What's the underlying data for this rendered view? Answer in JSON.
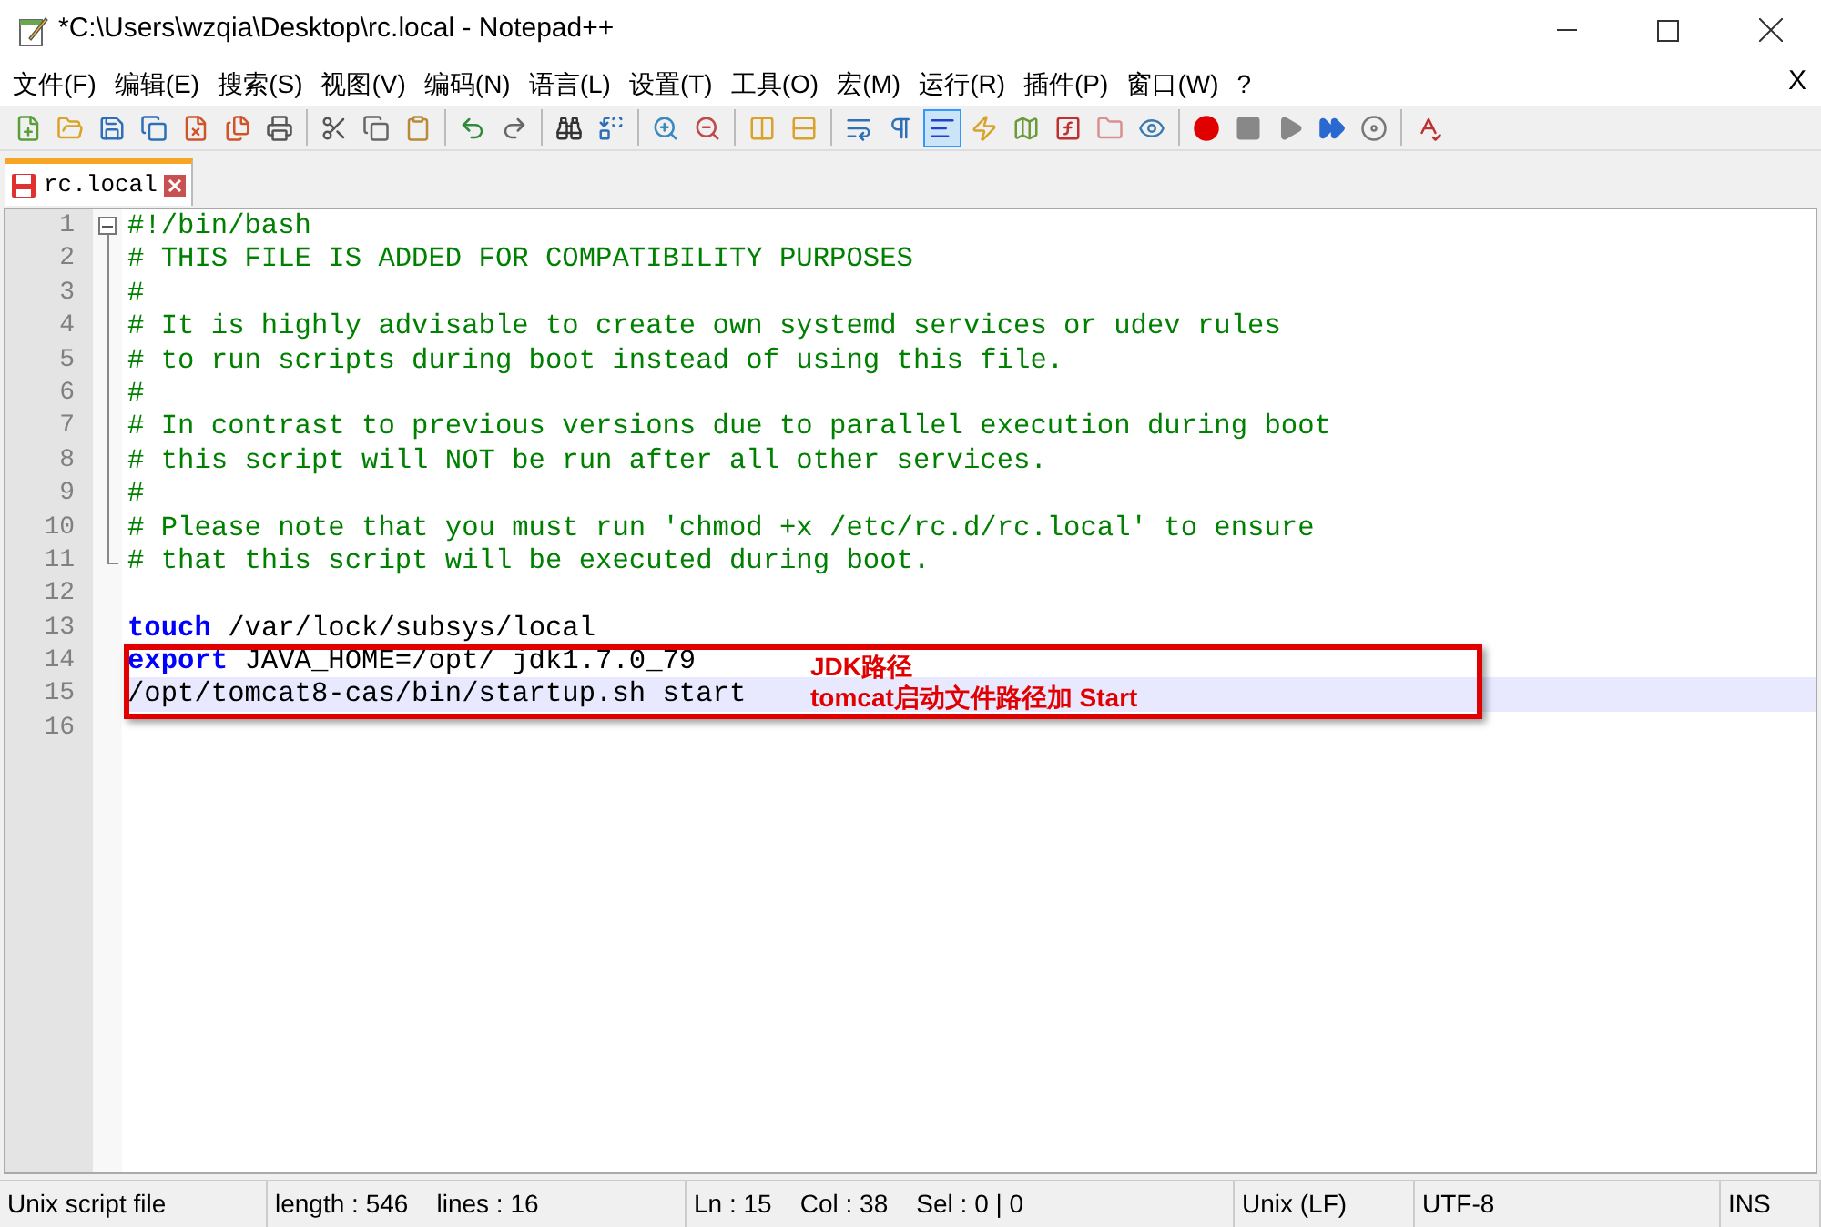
{
  "window": {
    "title": "*C:\\Users\\wzqia\\Desktop\\rc.local - Notepad++"
  },
  "menu": [
    {
      "label": "文件(F)"
    },
    {
      "label": "编辑(E)"
    },
    {
      "label": "搜索(S)"
    },
    {
      "label": "视图(V)"
    },
    {
      "label": "编码(N)"
    },
    {
      "label": "语言(L)"
    },
    {
      "label": "设置(T)"
    },
    {
      "label": "工具(O)"
    },
    {
      "label": "宏(M)"
    },
    {
      "label": "运行(R)"
    },
    {
      "label": "插件(P)"
    },
    {
      "label": "窗口(W)"
    },
    {
      "label": "?"
    }
  ],
  "menu_close": "X",
  "toolbar": [
    {
      "kind": "new",
      "active": false
    },
    {
      "kind": "open",
      "active": false
    },
    {
      "kind": "save",
      "active": false
    },
    {
      "kind": "saveall",
      "active": false
    },
    {
      "kind": "close",
      "active": false
    },
    {
      "kind": "closeall",
      "active": false
    },
    {
      "kind": "print",
      "active": false
    },
    {
      "kind": "sep"
    },
    {
      "kind": "cut",
      "active": false
    },
    {
      "kind": "copy",
      "active": false
    },
    {
      "kind": "paste",
      "active": false
    },
    {
      "kind": "sep"
    },
    {
      "kind": "undo",
      "active": false
    },
    {
      "kind": "redo",
      "active": false
    },
    {
      "kind": "sep"
    },
    {
      "kind": "find",
      "active": false
    },
    {
      "kind": "replace",
      "active": false
    },
    {
      "kind": "sep"
    },
    {
      "kind": "zoomin",
      "active": false
    },
    {
      "kind": "zoomout",
      "active": false
    },
    {
      "kind": "sep"
    },
    {
      "kind": "syncv",
      "active": false
    },
    {
      "kind": "synch",
      "active": false
    },
    {
      "kind": "sep"
    },
    {
      "kind": "wrap",
      "active": false
    },
    {
      "kind": "pilcrow",
      "active": false
    },
    {
      "kind": "indent",
      "active": true
    },
    {
      "kind": "udl",
      "active": false
    },
    {
      "kind": "map",
      "active": false
    },
    {
      "kind": "func",
      "active": false
    },
    {
      "kind": "folder",
      "active": false
    },
    {
      "kind": "eye",
      "active": false
    },
    {
      "kind": "sep"
    },
    {
      "kind": "record",
      "active": false
    },
    {
      "kind": "stop",
      "active": false
    },
    {
      "kind": "play",
      "active": false
    },
    {
      "kind": "playmulti",
      "active": false
    },
    {
      "kind": "savemacro",
      "active": false
    },
    {
      "kind": "sep"
    },
    {
      "kind": "spell",
      "active": false
    }
  ],
  "tabs": [
    {
      "label": "rc.local",
      "selected": true,
      "modified": true
    }
  ],
  "lines": [
    {
      "number": "1",
      "expanded": true,
      "current": false,
      "tokens": [
        {
          "kind": "comment",
          "text": "#!/bin/bash"
        }
      ],
      "children": [
        {
          "number": "2",
          "current": false,
          "tokens": [
            {
              "kind": "comment",
              "text": "# THIS FILE IS ADDED FOR COMPATIBILITY PURPOSES"
            }
          ]
        },
        {
          "number": "3",
          "current": false,
          "tokens": [
            {
              "kind": "comment",
              "text": "#"
            }
          ]
        },
        {
          "number": "4",
          "current": false,
          "tokens": [
            {
              "kind": "comment",
              "text": "# It is highly advisable to create own systemd services or udev rules"
            }
          ]
        },
        {
          "number": "5",
          "current": false,
          "tokens": [
            {
              "kind": "comment",
              "text": "# to run scripts during boot instead of using this file."
            }
          ]
        },
        {
          "number": "6",
          "current": false,
          "tokens": [
            {
              "kind": "comment",
              "text": "#"
            }
          ]
        },
        {
          "number": "7",
          "current": false,
          "tokens": [
            {
              "kind": "comment",
              "text": "# In contrast to previous versions due to parallel execution during boot"
            }
          ]
        },
        {
          "number": "8",
          "current": false,
          "tokens": [
            {
              "kind": "comment",
              "text": "# this script will NOT be run after all other services."
            }
          ]
        },
        {
          "number": "9",
          "current": false,
          "tokens": [
            {
              "kind": "comment",
              "text": "#"
            }
          ]
        },
        {
          "number": "10",
          "current": false,
          "tokens": [
            {
              "kind": "comment",
              "text": "# Please note that you must run 'chmod +x /etc/rc.d/rc.local' to ensure"
            }
          ]
        },
        {
          "number": "11",
          "current": false,
          "tokens": [
            {
              "kind": "comment",
              "text": "# that this script will be executed during boot."
            }
          ]
        }
      ]
    },
    {
      "number": "12",
      "current": false
    },
    {
      "number": "13",
      "current": false,
      "tokens": [
        {
          "kind": "keyword",
          "text": "touch"
        },
        {
          "kind": "plain",
          "text": " /var/lock/subsys/local"
        }
      ]
    },
    {
      "number": "14",
      "current": false,
      "tokens": [
        {
          "kind": "keyword",
          "text": "export"
        },
        {
          "kind": "plain",
          "text": " JAVA_HOME=/opt/ jdk1.7.0_79"
        }
      ]
    },
    {
      "number": "15",
      "current": true,
      "tokens": [
        {
          "kind": "plain",
          "text": "/opt/tomcat8-cas/bin/startup.sh start"
        }
      ]
    },
    {
      "number": "16",
      "current": false
    }
  ],
  "annotation": {
    "notes": [
      "JDK路径",
      "tomcat启动文件路径加 Start"
    ]
  },
  "status_bar": [
    {
      "text": "Unix script file"
    },
    {
      "text": "length : 546    lines : 16"
    },
    {
      "text": "Ln : 15    Col : 38    Sel : 0 | 0"
    },
    {
      "text": "Unix (LF)"
    },
    {
      "text": "UTF-8"
    },
    {
      "text": "INS"
    }
  ]
}
